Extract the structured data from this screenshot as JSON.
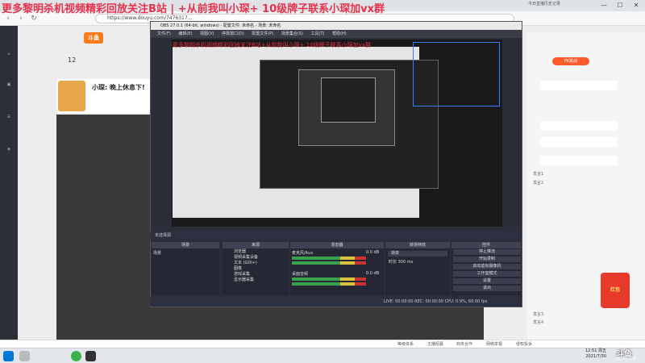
{
  "banner": {
    "main_text": "更多黎明杀机视频精彩回放关注B站 | +从前我叫小琛+   10级牌子联系小琛加vx群",
    "preview_text": "更多黎明杀机视频精彩回放关注B站+从前我叫小琛+  10级牌子联系小琛加vx群"
  },
  "browser": {
    "url": "https://www.douyu.com/7476317...",
    "history_link": "今日直播历史记录",
    "fire_badge": "火热"
  },
  "douyu": {
    "logo": "斗鱼",
    "fans_count": "12",
    "anchor_name": "小琛: 晚上休息下!",
    "pk_badge": "PK挑战",
    "right_items": [
      "发言1",
      "发言2",
      "发言3",
      "发言4"
    ],
    "redpack_label": "红包"
  },
  "obs": {
    "title": "OBS 27.0.1 (64-bit, windows) - 配置文件: 未命名 - 场景: 未命名",
    "menu": [
      "文件(F)",
      "编辑(E)",
      "视图(V)",
      "停靠窗口(D)",
      "配置文件(P)",
      "场景集合(S)",
      "工具(T)",
      "帮助(H)"
    ],
    "status_top": "未选择源",
    "docks": {
      "scenes": "场景",
      "sources": "来源",
      "mixer": "混音器",
      "transitions": "转场特效",
      "controls": "控件"
    },
    "scene_items": [
      "场景"
    ],
    "source_items": [
      "浏览器",
      "视频采集设备",
      "文本 (GDI+)",
      "图像",
      "游戏采集",
      "显示器采集"
    ],
    "mixer": [
      {
        "name": "麦克风/Aux",
        "value": "0.0 dB"
      },
      {
        "name": "桌面音频",
        "value": "0.0 dB"
      }
    ],
    "transition": {
      "mode": "渐变",
      "duration_label": "时长",
      "duration": "300 ms"
    },
    "controls": [
      "停止推流",
      "开始录制",
      "启动虚拟摄像机",
      "工作室模式",
      "设置",
      "退出"
    ],
    "status_bottom": "LIVE: 00:00:00   REC: 00:00:00   CPU: 0.9%, 60.00 fps"
  },
  "footer": {
    "items": [
      "等级体系",
      "主播招募",
      "商务合作",
      "网络举报",
      "侵权投诉"
    ]
  },
  "clock": {
    "time": "12:51 周五",
    "date": "2021/7/30"
  },
  "watermark": {
    "main": "斗鱼",
    "sub": "DOUYU.COM"
  }
}
